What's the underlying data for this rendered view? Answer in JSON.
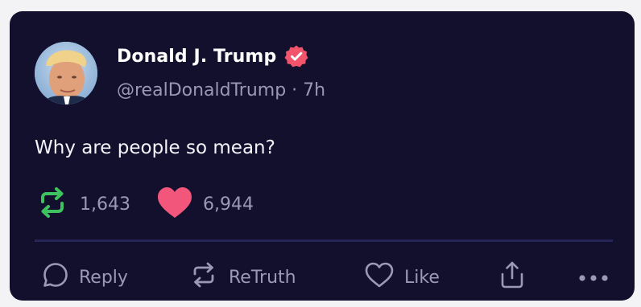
{
  "post": {
    "author": {
      "display_name": "Donald J. Trump",
      "verified": true,
      "handle_line": "@realDonaldTrump · 7h"
    },
    "text": "Why are people so mean?",
    "stats": {
      "retruths": "1,643",
      "likes": "6,944"
    }
  },
  "actions": {
    "reply_label": "Reply",
    "retruth_label": "ReTruth",
    "like_label": "Like"
  },
  "icons": {
    "verified": "verified-badge-icon",
    "retruth_stat": "retruth-icon",
    "like_stat": "heart-filled-icon",
    "reply": "comment-icon",
    "retruth": "retruth-icon",
    "like": "heart-outline-icon",
    "share": "share-icon",
    "more": "more-dots-icon"
  },
  "colors": {
    "card_background": "#13102e",
    "page_background": "#f3f3f6",
    "verified_badge": "#f2546b",
    "retruth_green": "#3ec15f",
    "heart_pink": "#f2567a",
    "muted_text": "#9b98b4",
    "divider": "#27245a"
  }
}
